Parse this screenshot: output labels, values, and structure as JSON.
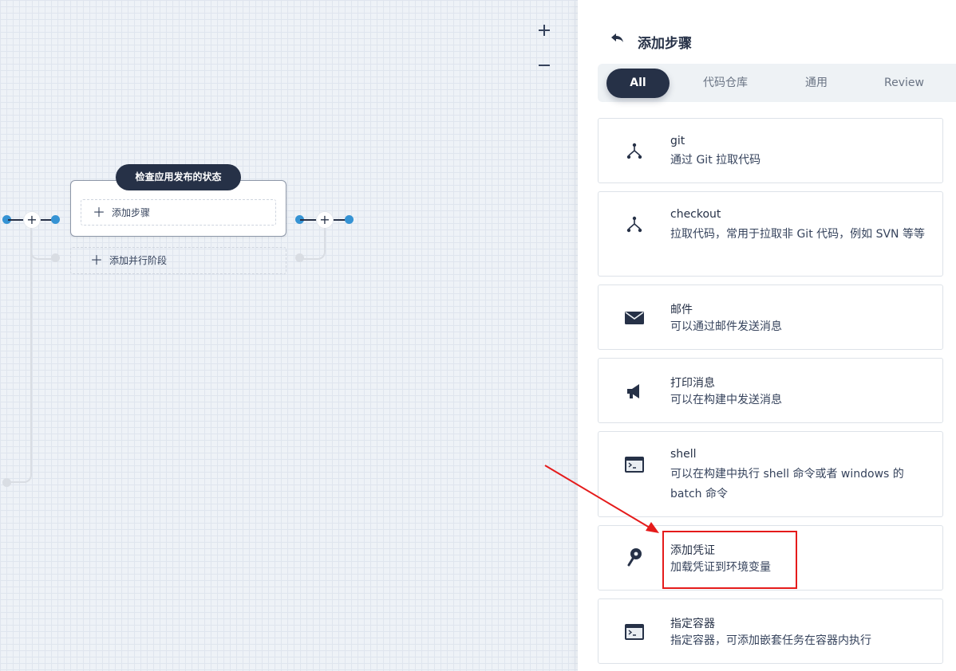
{
  "canvas": {
    "stage_title": "检查应用发布的状态",
    "add_step_label": "添加步骤",
    "add_parallel_label": "添加并行阶段",
    "zoom_in": "+",
    "zoom_out": "−"
  },
  "panel": {
    "title": "添加步骤",
    "tabs": [
      {
        "label": "All",
        "active": true
      },
      {
        "label": "代码仓库",
        "active": false
      },
      {
        "label": "通用",
        "active": false
      },
      {
        "label": "Review",
        "active": false
      }
    ],
    "steps": [
      {
        "icon": "git-branch-icon",
        "title": "git",
        "desc": "通过 Git 拉取代码"
      },
      {
        "icon": "git-branch-icon",
        "title": "checkout",
        "desc": "拉取代码，常用于拉取非 Git 代码，例如 SVN 等等"
      },
      {
        "icon": "mail-icon",
        "title": "邮件",
        "desc": "可以通过邮件发送消息"
      },
      {
        "icon": "megaphone-icon",
        "title": "打印消息",
        "desc": "可以在构建中发送消息"
      },
      {
        "icon": "terminal-icon",
        "title": "shell",
        "desc": "可以在构建中执行 shell 命令或者 windows 的 batch 命令"
      },
      {
        "icon": "key-icon",
        "title": "添加凭证",
        "desc": "加载凭证到环境变量"
      },
      {
        "icon": "terminal-icon",
        "title": "指定容器",
        "desc": "指定容器，可添加嵌套任务在容器内执行"
      }
    ]
  },
  "colors": {
    "dark": "#263147",
    "accent_blue": "#3593d4",
    "annotation_red": "#e51b1b"
  }
}
